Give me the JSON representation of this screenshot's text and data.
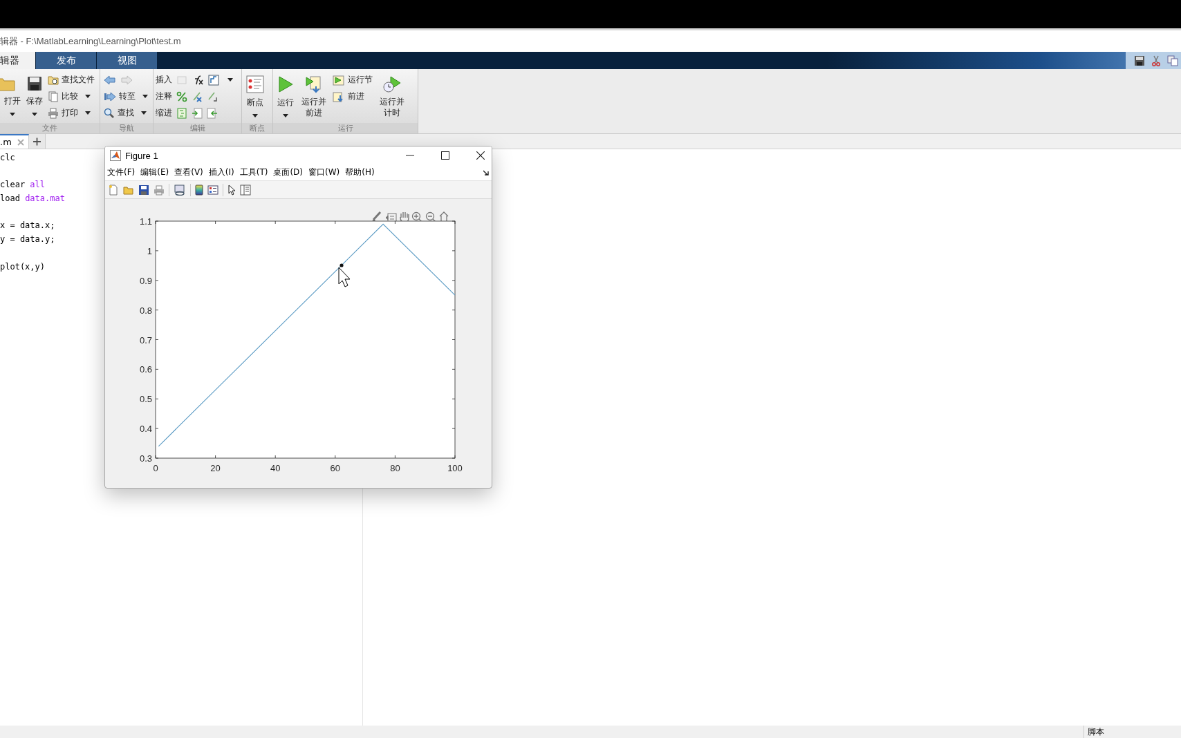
{
  "editor_title": "辑器 - F:\\MatlabLearning\\Learning\\Plot\\test.m",
  "ribbon_tabs": [
    {
      "label": "辑器",
      "selected": true
    },
    {
      "label": "发布",
      "selected": false
    },
    {
      "label": "视图",
      "selected": false
    }
  ],
  "ribbon_sections": [
    "文件",
    "导航",
    "编辑",
    "断点",
    "运行"
  ],
  "file_buttons": {
    "open": "打开",
    "save": "保存",
    "find_files": "查找文件",
    "compare": "比较",
    "print": "打印"
  },
  "navigate_buttons": {
    "go_to": "转至",
    "find": "查找"
  },
  "edit_rows": {
    "insert": "插入",
    "comment": "注释",
    "indent": "缩进"
  },
  "breakpoints_button": "断点",
  "run_buttons": {
    "run": "运行",
    "run_advance": "运行并前进",
    "run_section": "运行节",
    "advance": "前进",
    "run_time": "运行并计时"
  },
  "editor_tabs": [
    {
      "label": ".m",
      "selected": true
    }
  ],
  "code_lines": [
    {
      "kind": "code",
      "parts": [
        {
          "text": "clc",
          "kind": "plain"
        }
      ]
    },
    {
      "kind": "blank"
    },
    {
      "kind": "code",
      "parts": [
        {
          "text": "clear ",
          "kind": "plain"
        },
        {
          "text": "all",
          "kind": "string"
        }
      ]
    },
    {
      "kind": "code",
      "parts": [
        {
          "text": "load ",
          "kind": "plain"
        },
        {
          "text": "data.mat",
          "kind": "string"
        }
      ]
    },
    {
      "kind": "blank"
    },
    {
      "kind": "code",
      "parts": [
        {
          "text": "x = data.x;",
          "kind": "plain"
        }
      ]
    },
    {
      "kind": "code",
      "parts": [
        {
          "text": "y = data.y;",
          "kind": "plain"
        }
      ]
    },
    {
      "kind": "blank"
    },
    {
      "kind": "code",
      "parts": [
        {
          "text": "plot(x,y)",
          "kind": "plain"
        }
      ]
    }
  ],
  "figure": {
    "title": "Figure 1",
    "menu": [
      "文件(F)",
      "编辑(E)",
      "查看(V)",
      "插入(I)",
      "工具(T)",
      "桌面(D)",
      "窗口(W)",
      "帮助(H)"
    ],
    "chart_data": {
      "type": "line",
      "xlim": [
        0,
        100
      ],
      "ylim": [
        0.3,
        1.1
      ],
      "xticks": [
        0,
        20,
        40,
        60,
        80,
        100
      ],
      "yticks": [
        0.3,
        0.4,
        0.5,
        0.6,
        0.7,
        0.8,
        0.9,
        1,
        1.1
      ],
      "series": [
        {
          "color": "#5b9bc4",
          "x": [
            1,
            76,
            100
          ],
          "values": [
            0.34,
            1.09,
            0.85
          ]
        }
      ]
    }
  },
  "status_bar": {
    "file_type": "脚本"
  }
}
